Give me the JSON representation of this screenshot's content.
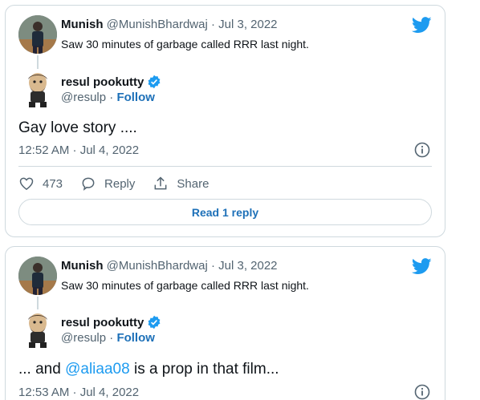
{
  "colors": {
    "twitter_blue": "#1d9bf0",
    "link_blue": "#1d70b8",
    "muted": "#536471",
    "border": "#cfd9de"
  },
  "cards": [
    {
      "quoted": {
        "name": "Munish",
        "handle": "@MunishBhardwaj",
        "separator": "·",
        "date": "Jul 3, 2022",
        "text": "Saw 30 minutes of garbage called RRR last night."
      },
      "author": {
        "name": "resul pookutty",
        "handle": "@resulp",
        "follow_label": "Follow"
      },
      "text": "Gay love story ....",
      "timestamp": "12:52 AM · Jul 4, 2022",
      "likes": "473",
      "reply_label": "Reply",
      "share_label": "Share",
      "read_replies_label": "Read 1 reply"
    },
    {
      "quoted": {
        "name": "Munish",
        "handle": "@MunishBhardwaj",
        "separator": "·",
        "date": "Jul 3, 2022",
        "text": "Saw 30 minutes of garbage called RRR last night."
      },
      "author": {
        "name": "resul pookutty",
        "handle": "@resulp",
        "follow_label": "Follow"
      },
      "text_prefix": "... and ",
      "mention": "@aliaa08",
      "text_suffix": " is a prop in that film...",
      "timestamp": "12:53 AM · Jul 4, 2022"
    }
  ]
}
